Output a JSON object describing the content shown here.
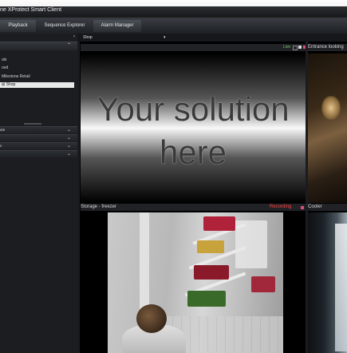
{
  "window": {
    "title": "ne XProtect Smart Client"
  },
  "tabs": [
    "Playback",
    "Sequence Explorer",
    "Alarm Manager"
  ],
  "sidebar": {
    "items": [
      "als",
      "oed",
      "Milestone Retail",
      "Shop"
    ],
    "selected": "Shop",
    "rows": [
      "ate",
      "",
      "s",
      ""
    ]
  },
  "view": {
    "name": "Shop"
  },
  "cameras": {
    "main": {
      "title": ""
    },
    "entrance": {
      "title": "Entrance looking"
    },
    "storage": {
      "title": "Storage - freezer",
      "status": "Recording"
    },
    "cooler": {
      "title": "Cooler"
    }
  },
  "live_label": "Live",
  "indicator_colors": {
    "live": "#77d166",
    "recording": "#ff4040",
    "marker": "#e04a7a"
  },
  "promo": {
    "line1": "Your solution",
    "line2": "here"
  }
}
